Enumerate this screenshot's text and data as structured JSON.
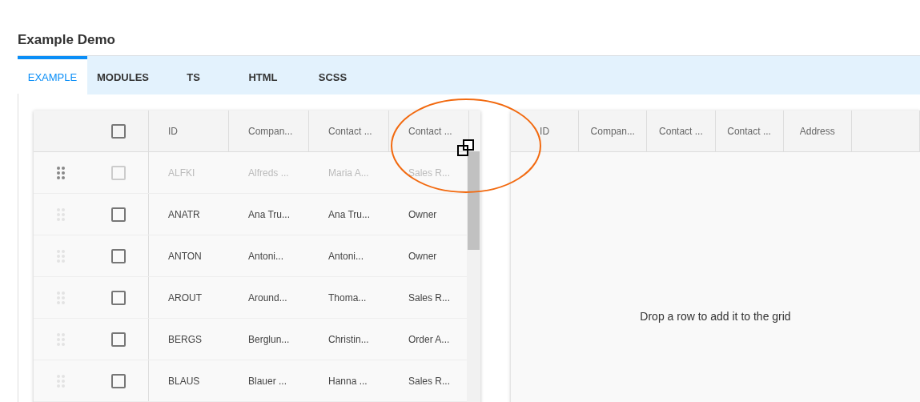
{
  "title": "Example Demo",
  "tabs": [
    {
      "label": "EXAMPLE",
      "selected": true
    },
    {
      "label": "MODULES",
      "selected": false
    },
    {
      "label": "TS",
      "selected": false
    },
    {
      "label": "HTML",
      "selected": false
    },
    {
      "label": "SCSS",
      "selected": false
    }
  ],
  "source_grid": {
    "header_checked": false,
    "columns": [
      "ID",
      "Compan...",
      "Contact ...",
      "Contact ..."
    ],
    "rows": [
      {
        "dragging": true,
        "checked": false,
        "cells": [
          "ALFKI",
          "Alfreds ...",
          "Maria A...",
          "Sales R..."
        ]
      },
      {
        "dragging": false,
        "checked": false,
        "cells": [
          "ANATR",
          "Ana Tru...",
          "Ana Tru...",
          "Owner"
        ]
      },
      {
        "dragging": false,
        "checked": false,
        "cells": [
          "ANTON",
          "Antoni...",
          "Antoni...",
          "Owner"
        ]
      },
      {
        "dragging": false,
        "checked": false,
        "cells": [
          "AROUT",
          "Around...",
          "Thoma...",
          "Sales R..."
        ]
      },
      {
        "dragging": false,
        "checked": false,
        "cells": [
          "BERGS",
          "Berglun...",
          "Christin...",
          "Order A..."
        ]
      },
      {
        "dragging": false,
        "checked": false,
        "cells": [
          "BLAUS",
          "Blauer ...",
          "Hanna ...",
          "Sales R..."
        ]
      }
    ]
  },
  "target_grid": {
    "columns": [
      "ID",
      "Compan...",
      "Contact ...",
      "Contact ...",
      "Address"
    ],
    "empty_message": "Drop a row to add it to the grid"
  }
}
